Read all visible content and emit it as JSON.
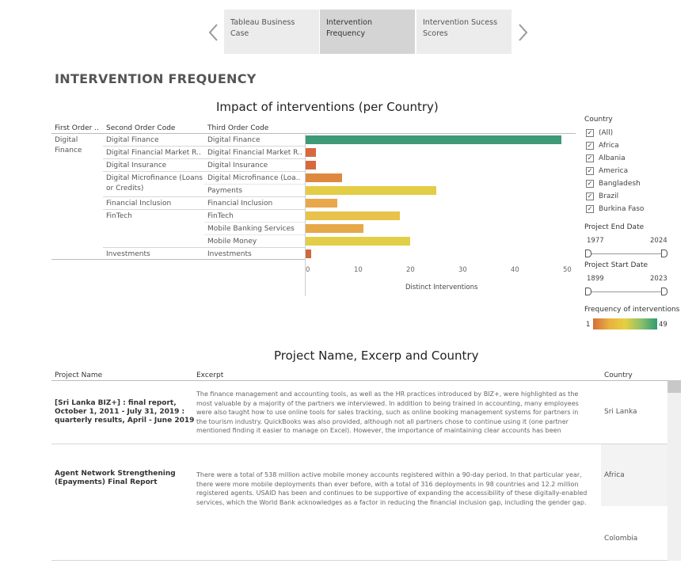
{
  "story_tabs": [
    {
      "label": "Tableau Business Case"
    },
    {
      "label": "Intervention Frequency"
    },
    {
      "label": "Intervention Sucess Scores"
    }
  ],
  "page_title": "INTERVENTION FREQUENCY",
  "chart_title": "Impact of interventions (per Country)",
  "headers": {
    "first": "First Order ..",
    "second": "Second Order Code",
    "third": "Third Order Code"
  },
  "first_order": "Digital Finance",
  "second_order": [
    "Digital Finance",
    "Digital Financial Market R..",
    "Digital Insurance",
    "Digital Microfinance (Loans or Credits)",
    "Financial Inclusion",
    "FinTech",
    "Investments"
  ],
  "third_order": [
    "Digital Finance",
    "Digital Financial Market R..",
    "Digital Insurance",
    "Digital Microfinance (Loa..",
    "Payments",
    "Financial Inclusion",
    "FinTech",
    "Mobile Banking Services",
    "Mobile Money",
    "Investments"
  ],
  "chart_data": {
    "type": "bar",
    "orientation": "horizontal",
    "categories": [
      "Digital Finance",
      "Digital Financial Market R..",
      "Digital Insurance",
      "Digital Microfinance (Loa..",
      "Payments",
      "Financial Inclusion",
      "FinTech",
      "Mobile Banking Services",
      "Mobile Money",
      "Investments"
    ],
    "values": [
      49,
      2,
      2,
      7,
      25,
      6,
      18,
      11,
      20,
      1
    ],
    "colors": [
      "#3e9a78",
      "#d66a3c",
      "#d66a3c",
      "#dd8a40",
      "#e3cd45",
      "#e8a74a",
      "#e8c24a",
      "#e6a848",
      "#e3ce47",
      "#d0683e"
    ],
    "xlabel": "Distinct Interventions",
    "xticks": [
      0,
      10,
      20,
      30,
      40,
      50
    ],
    "xlim": [
      0,
      50
    ]
  },
  "filters": {
    "country_title": "Country",
    "countries": [
      "(All)",
      "Africa",
      "Albania",
      "America",
      "Bangladesh",
      "Brazil",
      "Burkina Faso"
    ],
    "checkmark": "✓",
    "end_date": {
      "title": "Project End Date",
      "min": "1977",
      "max": "2024"
    },
    "start_date": {
      "title": "Project Start Date",
      "min": "1899",
      "max": "2023"
    },
    "legend": {
      "title": "Frequency of interventions",
      "min": "1",
      "max": "49"
    }
  },
  "table": {
    "title": "Project Name, Excerp and Country",
    "headers": {
      "name": "Project Name",
      "excerpt": "Excerpt",
      "country": "Country"
    },
    "rows": [
      {
        "name": "[Sri Lanka BIZ+] : final report, October 1, 2011 - July 31, 2019 : quarterly results, April - June 2019",
        "excerpt": "The finance management and accounting tools, as well as the HR practices introduced by BIZ+, were highlighted as the most valuable by a majority of the partners we interviewed. In addition to being trained in accounting, many employees were also taught how to use online tools for sales tracking, such as online booking management systems for partners in the tourism industry. QuickBooks was also provided, although not all partners chose to continue using it (one partner mentioned finding it easier to manage on Excel). However, the importance of maintaining clear accounts has been recogniz..",
        "country": "Sri Lanka"
      },
      {
        "name": "Agent Network Strengthening (Epayments) Final Report",
        "excerpt": "There were a total of 538 million active mobile money accounts registered within a 90-day period. In that particular year, there were more mobile deployments than ever before, with a total of 316 deployments in 98 countries and 12.2 million registered agents. USAID has been and continues to be supportive of expanding the accessibility of these digitally-enabled services, which the World Bank acknowledges as a factor in reducing the financial inclusion gap, including the gender gap.",
        "country": "Africa"
      },
      {
        "name": "",
        "excerpt": "",
        "country": "Colombia"
      }
    ]
  }
}
